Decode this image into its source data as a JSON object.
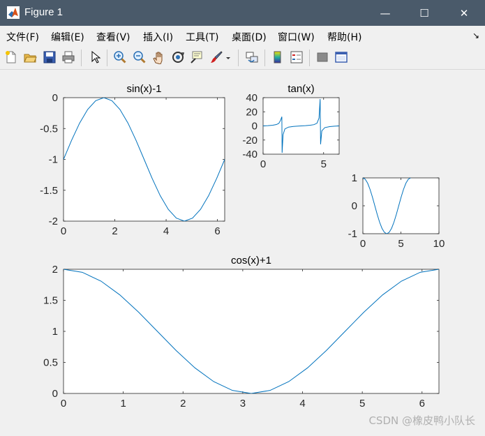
{
  "window": {
    "title": "Figure 1",
    "minimize_glyph": "—",
    "maximize_glyph": "☐",
    "close_glyph": "✕"
  },
  "menu": {
    "items": [
      "文件(F)",
      "编辑(E)",
      "查看(V)",
      "插入(I)",
      "工具(T)",
      "桌面(D)",
      "窗口(W)",
      "帮助(H)"
    ],
    "arrow": "↘"
  },
  "toolbar": {
    "icons": [
      "new-figure-icon",
      "open-file-icon",
      "save-icon",
      "print-icon",
      "select-arrow-icon",
      "zoom-in-icon",
      "zoom-out-icon",
      "pan-hand-icon",
      "rotate-3d-icon",
      "data-cursor-icon",
      "brush-icon",
      "brush-dropdown-icon",
      "link-plot-icon",
      "colorbar-icon",
      "legend-icon",
      "hide-plot-tools-icon",
      "show-plot-tools-icon"
    ]
  },
  "colors": {
    "line": "#0072bd",
    "axes_bg": "#ffffff",
    "fig_bg": "#f0f0f0"
  },
  "watermark": "CSDN @橡皮鸭小队长",
  "chart_data": [
    {
      "type": "line",
      "title": "sin(x)-1",
      "function": "sin(x)-1",
      "xlim": [
        0,
        6.283
      ],
      "ylim": [
        -2,
        0
      ],
      "xticks": [
        "0",
        "2",
        "4",
        "6"
      ],
      "xtick_values": [
        0,
        2,
        4,
        6
      ],
      "yticks": [
        "0",
        "-0.5",
        "-1",
        "-1.5",
        "-2"
      ],
      "ytick_values": [
        0,
        -0.5,
        -1,
        -1.5,
        -2
      ],
      "points": [
        [
          0,
          -1
        ],
        [
          0.314,
          -0.691
        ],
        [
          0.628,
          -0.412
        ],
        [
          0.942,
          -0.191
        ],
        [
          1.257,
          -0.049
        ],
        [
          1.571,
          0
        ],
        [
          1.885,
          -0.049
        ],
        [
          2.199,
          -0.191
        ],
        [
          2.513,
          -0.412
        ],
        [
          2.827,
          -0.691
        ],
        [
          3.142,
          -1
        ],
        [
          3.456,
          -1.309
        ],
        [
          3.77,
          -1.588
        ],
        [
          4.084,
          -1.809
        ],
        [
          4.398,
          -1.951
        ],
        [
          4.712,
          -2
        ],
        [
          5.027,
          -1.951
        ],
        [
          5.341,
          -1.809
        ],
        [
          5.655,
          -1.588
        ],
        [
          5.969,
          -1.309
        ],
        [
          6.283,
          -1
        ]
      ]
    },
    {
      "type": "line",
      "title": "tan(x)",
      "function": "tan(x)",
      "xlim": [
        0,
        6.283
      ],
      "ylim": [
        -40,
        40
      ],
      "xticks": [
        "0",
        "5"
      ],
      "xtick_values": [
        0,
        5
      ],
      "yticks": [
        "40",
        "20",
        "0",
        "-20",
        "-40"
      ],
      "ytick_values": [
        40,
        20,
        0,
        -20,
        -40
      ],
      "points": [
        [
          0,
          0
        ],
        [
          0.4,
          0.42
        ],
        [
          0.8,
          1.03
        ],
        [
          1.1,
          1.96
        ],
        [
          1.3,
          3.6
        ],
        [
          1.45,
          8.2
        ],
        [
          1.55,
          13
        ],
        [
          1.571,
          -38
        ],
        [
          1.65,
          -12.5
        ],
        [
          1.8,
          -4.3
        ],
        [
          2.1,
          -1.7
        ],
        [
          2.5,
          -0.75
        ],
        [
          2.9,
          -0.25
        ],
        [
          3.142,
          0
        ],
        [
          3.5,
          0.37
        ],
        [
          3.9,
          0.95
        ],
        [
          4.2,
          1.78
        ],
        [
          4.45,
          3.8
        ],
        [
          4.62,
          11
        ],
        [
          4.712,
          38
        ],
        [
          4.75,
          -26
        ],
        [
          4.85,
          -7
        ],
        [
          5.1,
          -2.4
        ],
        [
          5.5,
          -1.0
        ],
        [
          5.9,
          -0.4
        ],
        [
          6.283,
          0
        ]
      ]
    },
    {
      "type": "line",
      "title": "",
      "function": "cos(x)",
      "xlim": [
        0,
        10
      ],
      "ylim": [
        -1,
        1
      ],
      "xticks": [
        "0",
        "5",
        "10"
      ],
      "xtick_values": [
        0,
        5,
        10
      ],
      "yticks": [
        "1",
        "0",
        "-1"
      ],
      "ytick_values": [
        1,
        0,
        -1
      ],
      "points": [
        [
          0,
          1
        ],
        [
          0.314,
          0.951
        ],
        [
          0.628,
          0.809
        ],
        [
          0.942,
          0.588
        ],
        [
          1.257,
          0.309
        ],
        [
          1.571,
          0
        ],
        [
          1.885,
          -0.309
        ],
        [
          2.199,
          -0.588
        ],
        [
          2.513,
          -0.809
        ],
        [
          2.827,
          -0.951
        ],
        [
          3.142,
          -1
        ],
        [
          3.456,
          -0.951
        ],
        [
          3.77,
          -0.809
        ],
        [
          4.084,
          -0.588
        ],
        [
          4.398,
          -0.309
        ],
        [
          4.712,
          0
        ],
        [
          5.027,
          0.309
        ],
        [
          5.341,
          0.588
        ],
        [
          5.655,
          0.809
        ],
        [
          5.969,
          0.951
        ],
        [
          6.283,
          1
        ]
      ]
    },
    {
      "type": "line",
      "title": "cos(x)+1",
      "function": "cos(x)+1",
      "xlim": [
        0,
        6.283
      ],
      "ylim": [
        0,
        2
      ],
      "xticks": [
        "0",
        "1",
        "2",
        "3",
        "4",
        "5",
        "6"
      ],
      "xtick_values": [
        0,
        1,
        2,
        3,
        4,
        5,
        6
      ],
      "yticks": [
        "2",
        "1.5",
        "1",
        "0.5",
        "0"
      ],
      "ytick_values": [
        2,
        1.5,
        1,
        0.5,
        0
      ],
      "points": [
        [
          0,
          2
        ],
        [
          0.314,
          1.951
        ],
        [
          0.628,
          1.809
        ],
        [
          0.942,
          1.588
        ],
        [
          1.257,
          1.309
        ],
        [
          1.571,
          1
        ],
        [
          1.885,
          0.691
        ],
        [
          2.199,
          0.412
        ],
        [
          2.513,
          0.191
        ],
        [
          2.827,
          0.049
        ],
        [
          3.142,
          0
        ],
        [
          3.456,
          0.049
        ],
        [
          3.77,
          0.191
        ],
        [
          4.084,
          0.412
        ],
        [
          4.398,
          0.691
        ],
        [
          4.712,
          1
        ],
        [
          5.027,
          1.309
        ],
        [
          5.341,
          1.588
        ],
        [
          5.655,
          1.809
        ],
        [
          5.969,
          1.951
        ],
        [
          6.283,
          2
        ]
      ]
    }
  ]
}
